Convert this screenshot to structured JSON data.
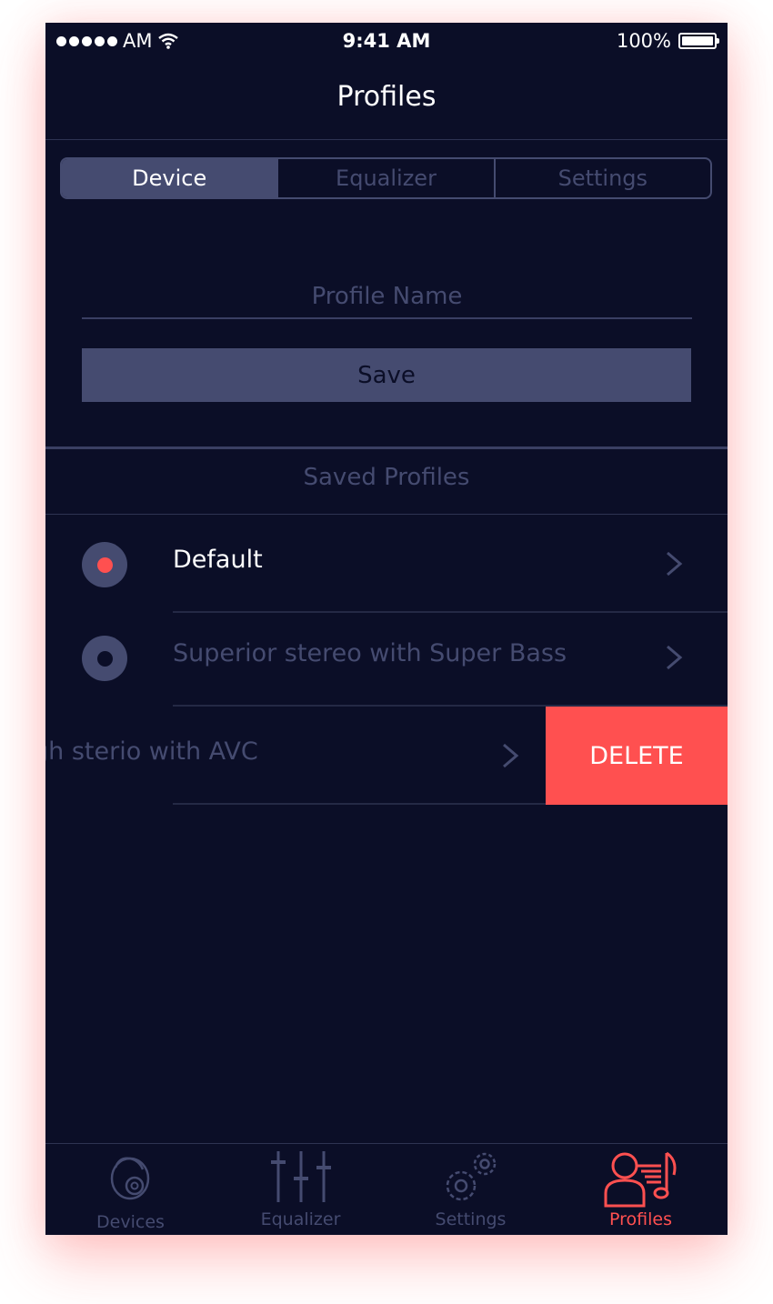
{
  "status_bar": {
    "carrier": "AM",
    "time": "9:41 AM",
    "battery": "100%"
  },
  "nav": {
    "title": "Profiles"
  },
  "segments": [
    "Device",
    "Equalizer",
    "Settings"
  ],
  "profile_name": {
    "placeholder": "Profile Name",
    "value": ""
  },
  "save_label": "Save",
  "saved_profiles_title": "Saved Profiles",
  "profiles": [
    {
      "name": "Default",
      "selected": true
    },
    {
      "name": "Superior stereo with Super Bass",
      "selected": false
    },
    {
      "name": "gh sterio with AVC",
      "selected": false
    }
  ],
  "delete_label": "DELETE",
  "tabs": [
    {
      "label": "Devices",
      "icon": "earbud-icon"
    },
    {
      "label": "Equalizer",
      "icon": "equalizer-icon"
    },
    {
      "label": "Settings",
      "icon": "gears-icon"
    },
    {
      "label": "Profiles",
      "icon": "profile-music-icon",
      "active": true
    }
  ],
  "colors": {
    "background": "#0b0e27",
    "accent": "#ff5050",
    "muted": "#454b70",
    "text": "#ffffff"
  }
}
